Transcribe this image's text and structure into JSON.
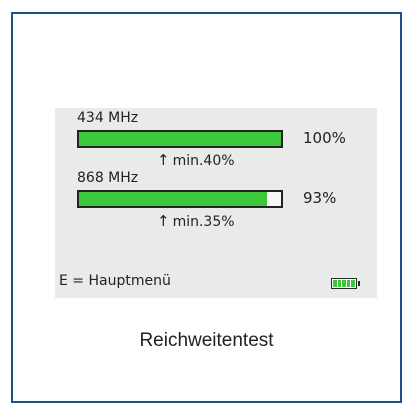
{
  "display": {
    "channels": [
      {
        "frequency": "434 MHz",
        "fill": 1.0,
        "percent": "100%",
        "minimum": "min.40%"
      },
      {
        "frequency": "868 MHz",
        "fill": 0.93,
        "percent": "93%",
        "minimum": "min.35%"
      }
    ],
    "menu_hint": "E = Hauptmenü",
    "battery_icon": "battery-full-icon",
    "battery_level": 1.0
  },
  "caption": "Reichweitentest",
  "colors": {
    "frame_border": "#1f4e8c",
    "screen_background": "#e9eaea",
    "signal_bar": "#3bc93b",
    "battery_fill": "#3bc93b"
  }
}
